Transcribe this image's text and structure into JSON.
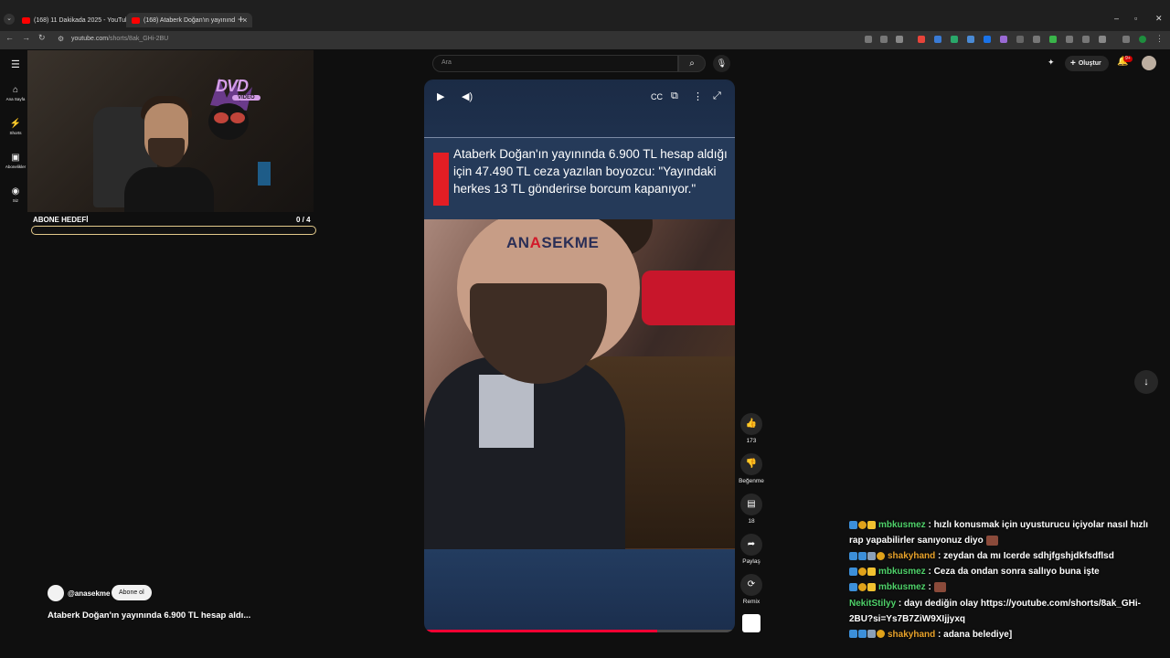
{
  "browser": {
    "tabs": [
      {
        "title": "(168) 11 Dakikada 2025 - YouTube",
        "active": false
      },
      {
        "title": "(168) Ataberk Doğan'ın yayınınd",
        "active": true
      }
    ],
    "url_host": "youtube.com",
    "url_path": "/shorts/8ak_GHi-2BU"
  },
  "masthead": {
    "search_placeholder": "Ara",
    "create_label": "Oluştur",
    "notif_badge": "9+"
  },
  "rail": [
    {
      "label": "Ana Sayfa",
      "icon": "home-icon"
    },
    {
      "label": "Shorts",
      "icon": "shorts-icon"
    },
    {
      "label": "Abonelikler",
      "icon": "subscriptions-icon"
    },
    {
      "label": "Siz",
      "icon": "you-icon"
    }
  ],
  "stream_overlay": {
    "logo_text": "DVD",
    "logo_sub": "VIDEO",
    "goal_label": "ABONE HEDEFİ",
    "goal_count": "0  / 4",
    "goal_progress": 0
  },
  "short": {
    "headline": "Ataberk Doğan'ın yayınında 6.900 TL hesap aldığı için 47.490 TL ceza yazılan boyozcu: \"Yayındaki herkes 13 TL gönderirse borcum kapanıyor.\"",
    "watermark_pre": "AN",
    "watermark_a": "A",
    "watermark_post": "SEKME",
    "progress": 0.75,
    "channel": "@anasekme",
    "subscribe_label": "Abone ol",
    "title": "Ataberk Doğan'ın yayınında 6.900 TL hesap aldı..."
  },
  "actions": {
    "like_count": "173",
    "dislike_label": "Beğenme",
    "comment_count": "18",
    "share_label": "Paylaş",
    "remix_label": "Remix"
  },
  "chat": [
    {
      "user": "mbkusmez",
      "color": "green",
      "badges": [
        "blue",
        "gold",
        "yellow"
      ],
      "text": ": hızlı konusmak için uyusturucu içiyolar nasıl hızlı rap yapabilirler sanıyonuz diyo",
      "emote": true
    },
    {
      "user": "shakyhand",
      "color": "orange",
      "badges": [
        "blue",
        "blue",
        "gray",
        "gold"
      ],
      "text": ": zeydan da mı Icerde sdhjfgshjdkfsdflsd",
      "emote": false
    },
    {
      "user": "mbkusmez",
      "color": "green",
      "badges": [
        "blue",
        "gold",
        "yellow"
      ],
      "text": ": Ceza da ondan sonra sallıyo buna işte",
      "emote": false
    },
    {
      "user": "mbkusmez",
      "color": "green",
      "badges": [
        "blue",
        "gold",
        "yellow"
      ],
      "text": ":",
      "emote": true
    },
    {
      "user": "NekitStilyy",
      "color": "green",
      "badges": [],
      "text": ": dayı dediğin olay https://youtube.com/shorts/8ak_GHi-2BU?si=Ys7B7ZiW9XIjjyxq",
      "emote": false
    },
    {
      "user": "shakyhand",
      "color": "orange",
      "badges": [
        "blue",
        "blue",
        "gray",
        "gold"
      ],
      "text": ": adana belediye]",
      "emote": false
    }
  ]
}
